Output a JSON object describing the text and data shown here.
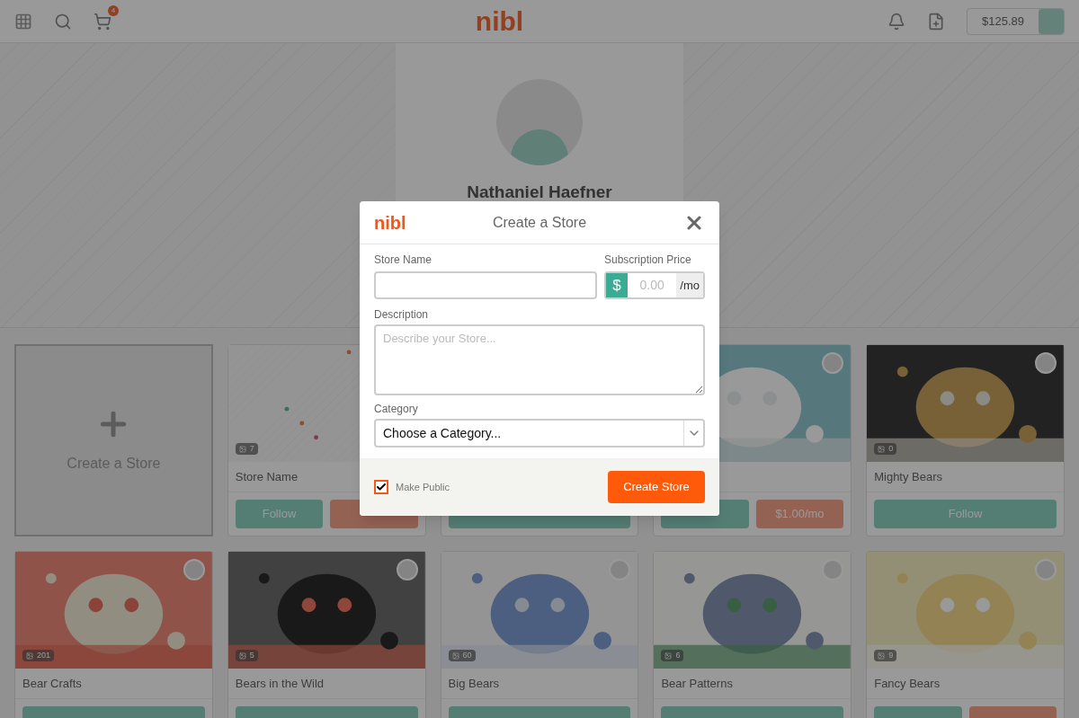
{
  "header": {
    "logo": "nibl",
    "cart_count": "4",
    "balance": "$125.89"
  },
  "profile": {
    "name": "Nathaniel Haefner"
  },
  "create_tile": {
    "label": "Create a Store"
  },
  "cards": [
    {
      "kind": "pattern",
      "count": "7",
      "title": "Store Name",
      "buttons": [
        {
          "kind": "follow",
          "label": "Follow"
        },
        {
          "kind": "price"
        }
      ]
    },
    {
      "buttons": [
        {
          "kind": "follow"
        }
      ]
    },
    {
      "kind": "picture",
      "buttons": [
        {
          "kind": "follow"
        },
        {
          "kind": "price",
          "label": "$1.00/mo"
        }
      ]
    },
    {
      "kind": "picture",
      "count": "0",
      "title": "Mighty Bears",
      "buttons": [
        {
          "kind": "follow",
          "label": "Follow"
        }
      ]
    },
    {
      "kind": "picture",
      "count": "201",
      "title": "Bear Crafts",
      "buttons": [
        {
          "kind": "follow"
        }
      ]
    },
    {
      "kind": "picture",
      "count": "5",
      "title": "Bears in the Wild",
      "buttons": [
        {
          "kind": "follow"
        }
      ]
    },
    {
      "kind": "picture",
      "count": "60",
      "title": "Big Bears",
      "buttons": [
        {
          "kind": "follow"
        }
      ]
    },
    {
      "kind": "picture",
      "count": "6",
      "title": "Bear Patterns",
      "buttons": [
        {
          "kind": "follow"
        }
      ]
    },
    {
      "kind": "picture",
      "count": "9",
      "title": "Fancy Bears",
      "buttons": [
        {
          "kind": "follow"
        },
        {
          "kind": "price"
        }
      ]
    }
  ],
  "modal": {
    "logo": "nibl",
    "title": "Create a Store",
    "store_name_label": "Store Name",
    "price_label": "Subscription Price",
    "currency": "$",
    "price_placeholder": "0.00",
    "unit": "/mo",
    "description_label": "Description",
    "description_placeholder": "Describe your Store...",
    "category_label": "Category",
    "category_value": "Choose a Category...",
    "make_public": {
      "label": "Make Public",
      "checked": true
    },
    "submit": "Create Store"
  }
}
